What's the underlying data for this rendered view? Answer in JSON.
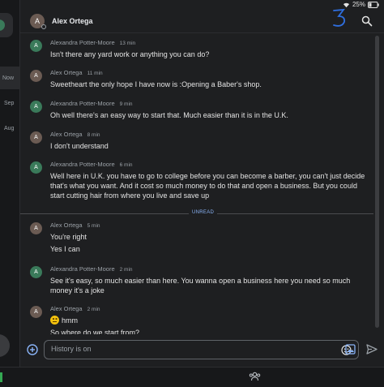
{
  "statusbar": {
    "battery_text": "25%"
  },
  "header": {
    "contact_name": "Alex Ortega",
    "avatar_initial": "A"
  },
  "sidebar": {
    "dates": [
      "Now",
      "Sep",
      "Aug"
    ]
  },
  "unread_label": "UNREAD",
  "messages": [
    {
      "sender": "Alexandra Potter-Moore",
      "time": "13 min",
      "initial": "A",
      "avatar_color": "#3a7a5a",
      "lines": [
        "Isn't there any yard work or anything you can do?"
      ]
    },
    {
      "sender": "Alex Ortega",
      "time": "11 min",
      "initial": "A",
      "avatar_color": "#6b5b53",
      "lines": [
        "Sweetheart the only hope I have now is :Opening a Baber's shop."
      ]
    },
    {
      "sender": "Alexandra Potter-Moore",
      "time": "9 min",
      "initial": "A",
      "avatar_color": "#3a7a5a",
      "lines": [
        "Oh well there's an easy way to start that. Much easier than it is in the U.K."
      ]
    },
    {
      "sender": "Alex Ortega",
      "time": "8 min",
      "initial": "A",
      "avatar_color": "#6b5b53",
      "lines": [
        "I don't understand"
      ]
    },
    {
      "sender": "Alexandra Potter-Moore",
      "time": "6 min",
      "initial": "A",
      "avatar_color": "#3a7a5a",
      "lines": [
        "Well here in U.K. you have to go to college before you can become a barber, you can't just decide that's what you want. And it cost so much money to do that and open a business. But you could start cutting hair from where you live and save up"
      ]
    },
    {
      "sender": "Alex Ortega",
      "time": "5 min",
      "initial": "A",
      "avatar_color": "#6b5b53",
      "lines": [
        "You're right",
        "Yes I can"
      ]
    },
    {
      "sender": "Alexandra Potter-Moore",
      "time": "2 min",
      "initial": "A",
      "avatar_color": "#3a7a5a",
      "lines": [
        "See it's easy, so much easier than here. You wanna open a business here you need so much money it's a joke"
      ]
    },
    {
      "sender": "Alex Ortega",
      "time": "2 min",
      "initial": "A",
      "avatar_color": "#6b5b53",
      "lines": [
        "hmm",
        "So where do we start from?"
      ]
    }
  ],
  "composer": {
    "input_value": "History is on"
  },
  "icons": {
    "search": "search-icon",
    "add": "add-icon",
    "emoji": "emoji-icon",
    "image": "image-icon",
    "send": "send-icon",
    "people": "people-icon",
    "wifi": "wifi-icon",
    "battery": "battery-icon"
  },
  "colors": {
    "accent": "#8ab4f8",
    "background": "#1e1f21"
  }
}
